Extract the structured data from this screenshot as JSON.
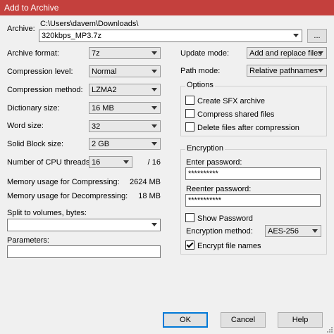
{
  "window": {
    "title": "Add to Archive"
  },
  "archive": {
    "label": "Archive:",
    "path": "C:\\Users\\davem\\Downloads\\",
    "filename": "320kbps_MP3.7z",
    "browse_label": "..."
  },
  "left": {
    "archive_format": {
      "label": "Archive format:",
      "value": "7z"
    },
    "compression_level": {
      "label": "Compression level:",
      "value": "Normal"
    },
    "compression_method": {
      "label": "Compression method:",
      "value": "LZMA2"
    },
    "dictionary_size": {
      "label": "Dictionary size:",
      "value": "16 MB"
    },
    "word_size": {
      "label": "Word size:",
      "value": "32"
    },
    "solid_block_size": {
      "label": "Solid Block size:",
      "value": "2 GB"
    },
    "cpu_threads": {
      "label": "Number of CPU threads:",
      "value": "16",
      "max": "/ 16"
    },
    "mem_compress": {
      "label": "Memory usage for Compressing:",
      "value": "2624 MB"
    },
    "mem_decompress": {
      "label": "Memory usage for Decompressing:",
      "value": "18 MB"
    },
    "split": {
      "label": "Split to volumes, bytes:",
      "value": ""
    },
    "parameters": {
      "label": "Parameters:",
      "value": ""
    }
  },
  "right": {
    "update_mode": {
      "label": "Update mode:",
      "value": "Add and replace files"
    },
    "path_mode": {
      "label": "Path mode:",
      "value": "Relative pathnames"
    },
    "options": {
      "caption": "Options",
      "sfx": {
        "label": "Create SFX archive",
        "checked": false
      },
      "shared": {
        "label": "Compress shared files",
        "checked": false
      },
      "delete": {
        "label": "Delete files after compression",
        "checked": false
      }
    },
    "encryption": {
      "caption": "Encryption",
      "enter_label": "Enter password:",
      "enter_value": "**********",
      "reenter_label": "Reenter password:",
      "reenter_value": "***********",
      "show_password": {
        "label": "Show Password",
        "checked": false
      },
      "method_label": "Encryption method:",
      "method_value": "AES-256",
      "encrypt_names": {
        "label": "Encrypt file names",
        "checked": true
      }
    }
  },
  "buttons": {
    "ok": "OK",
    "cancel": "Cancel",
    "help": "Help"
  }
}
